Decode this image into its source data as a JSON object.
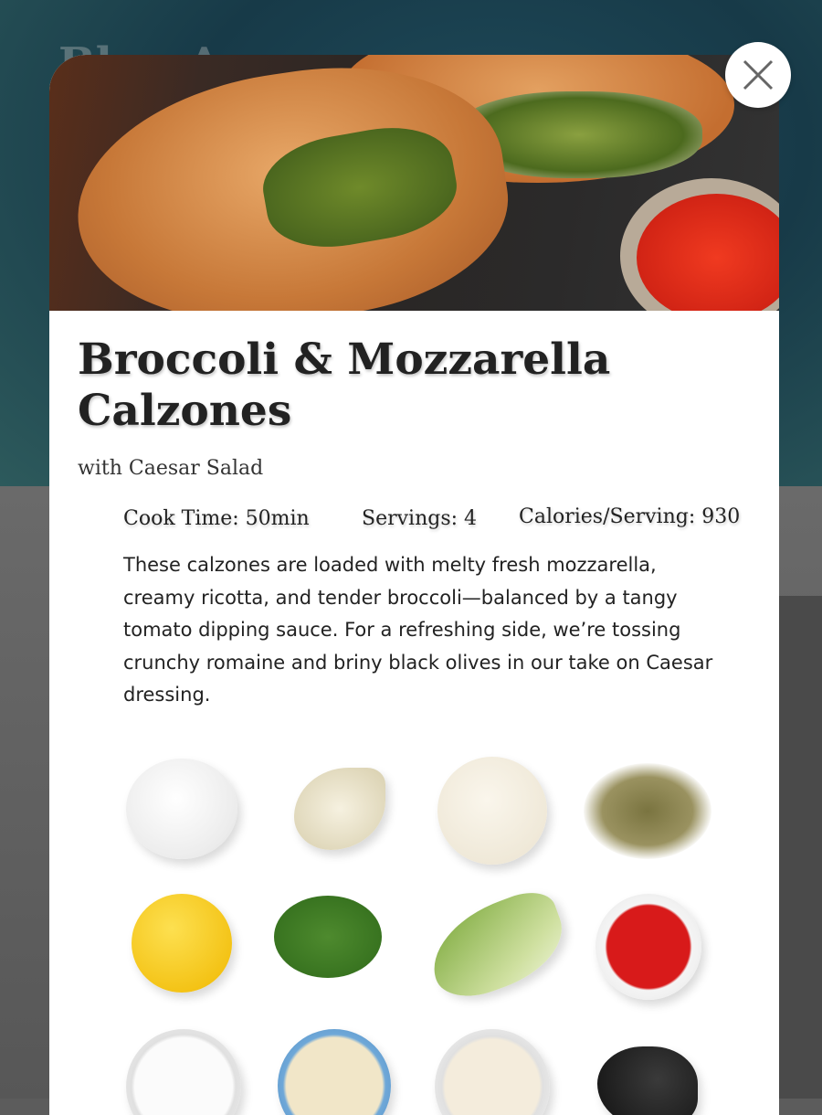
{
  "background": {
    "partial_text": "Blue Apron"
  },
  "close_button": {
    "icon": "close-icon",
    "symbol": "✕"
  },
  "recipe": {
    "title": "Broccoli & Mozzarella Calzones",
    "subtitle": "with Caesar Salad",
    "stats": {
      "cook_time": "Cook Time: 50min",
      "servings": "Servings: 4",
      "calories": "Calories/Serving: 930"
    },
    "description": "These calzones are loaded with melty fresh mozzarella, creamy ricotta, and tender broccoli—balanced by a tangy tomato dipping sauce. For a refreshing side, we’re tossing crunchy romaine and briny black olives in our take on Caesar dressing.",
    "ingredient_icons": [
      "mozzarella-icon",
      "garlic-icon",
      "dough-icon",
      "oregano-icon",
      "lemon-icon",
      "broccoli-icon",
      "romaine-icon",
      "tomato-sauce-icon",
      "ricotta-icon",
      "parmesan-icon",
      "mayonnaise-icon",
      "olives-icon"
    ]
  }
}
